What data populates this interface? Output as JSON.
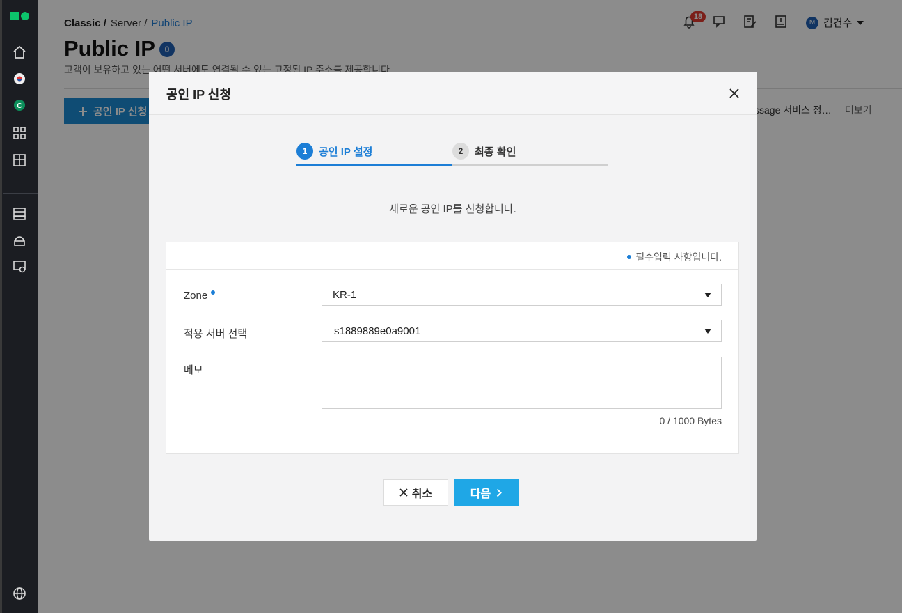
{
  "breadcrumb": {
    "root": "Classic /",
    "mid": "Server /",
    "current": "Public IP"
  },
  "page": {
    "title": "Public IP",
    "count": "0",
    "description": "고객이 보유하고 있는 어떤 서버에도 연결될 수 있는 고정된 IP 주소를 제공합니다.",
    "apply_button": "공인 IP 신청",
    "notice_text": "ssage 서비스 정…",
    "more_label": "더보기"
  },
  "header": {
    "notification_count": "18",
    "user_initial": "M",
    "user_name": "김건수"
  },
  "modal": {
    "title": "공인 IP 신청",
    "steps": [
      {
        "num": "1",
        "label": "공인 IP 설정"
      },
      {
        "num": "2",
        "label": "최종 확인"
      }
    ],
    "intro": "새로운 공인 IP를 신청합니다.",
    "required_note": "필수입력 사항입니다.",
    "fields": {
      "zone_label": "Zone",
      "zone_value": "KR-1",
      "server_label": "적용 서버 선택",
      "server_value": "s1889889e0a9001",
      "memo_label": "메모",
      "memo_value": "",
      "memo_bytes": "0 / 1000 Bytes"
    },
    "cancel_label": "취소",
    "next_label": "다음"
  },
  "colors": {
    "accent": "#1c7ed6",
    "primary_button": "#1fa7e6",
    "rail": "#1b1d22"
  }
}
